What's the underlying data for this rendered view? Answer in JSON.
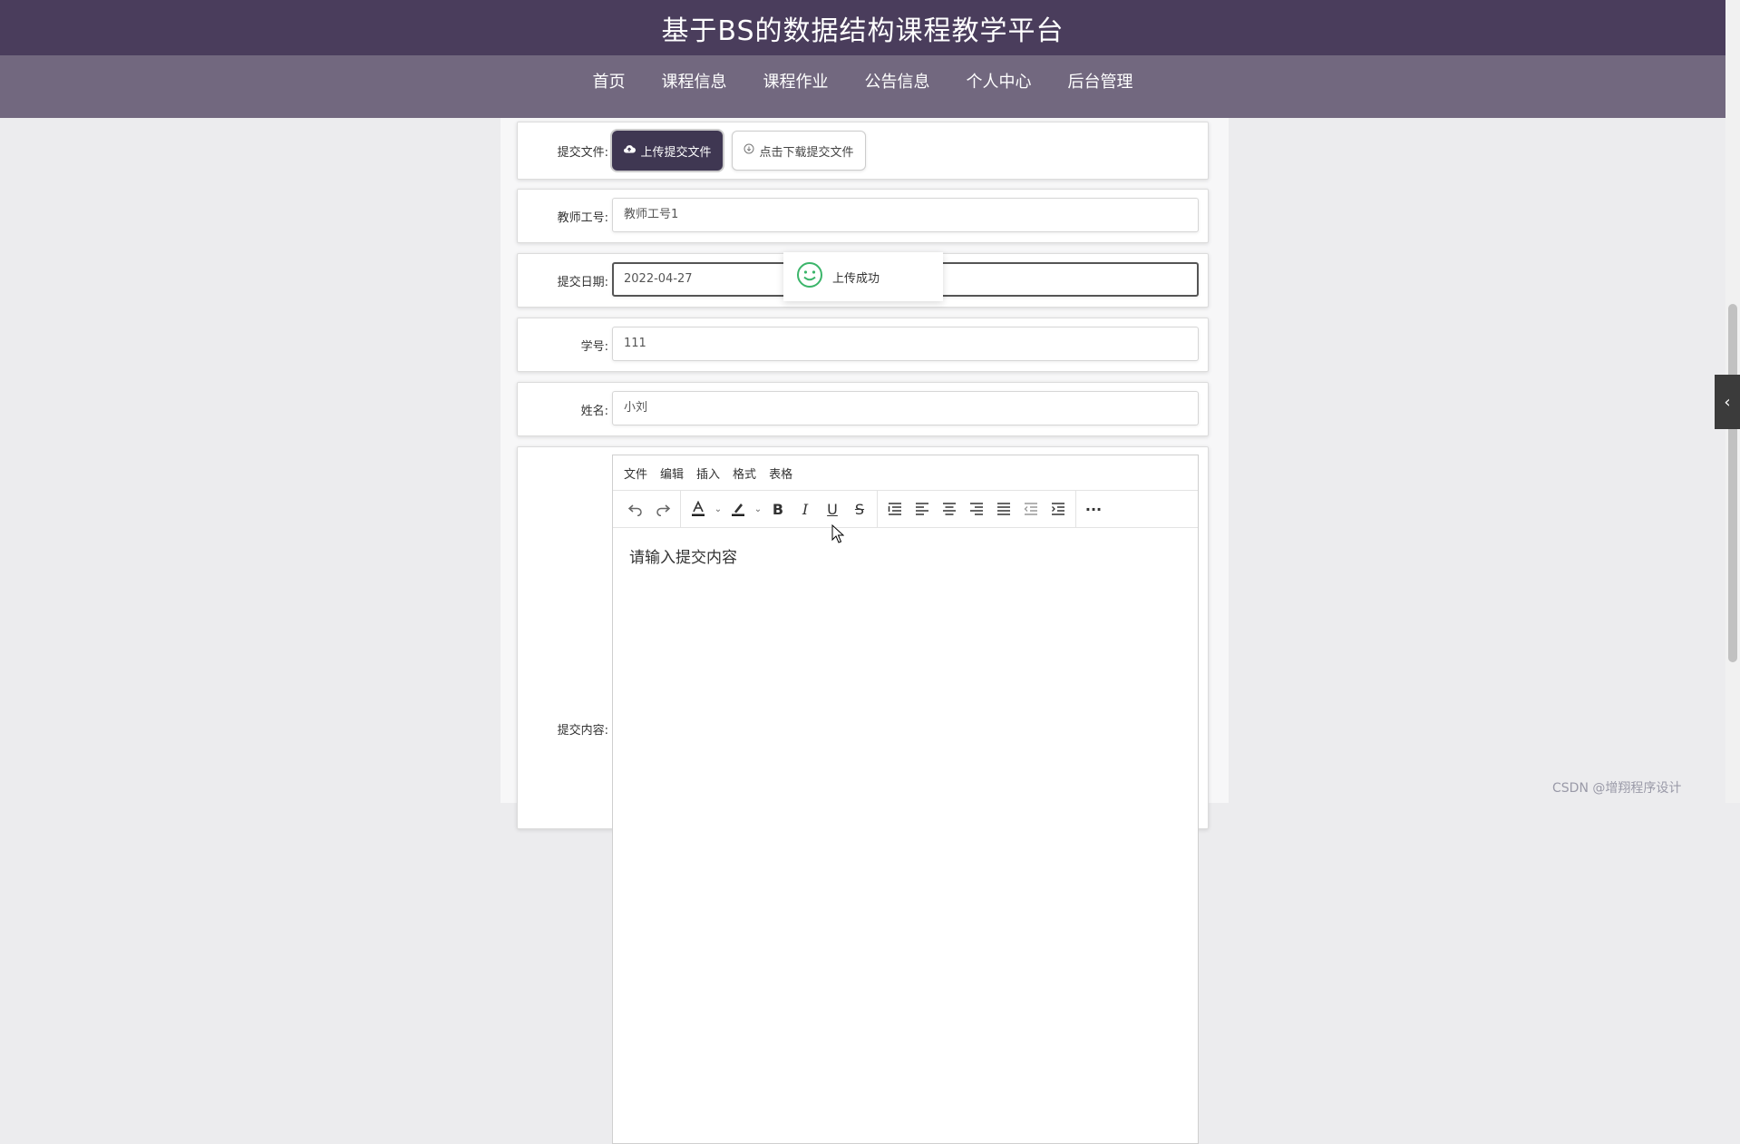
{
  "header": {
    "title": "基于BS的数据结构课程教学平台"
  },
  "nav": {
    "items": [
      {
        "label": "首页"
      },
      {
        "label": "课程信息"
      },
      {
        "label": "课程作业",
        "active": true
      },
      {
        "label": "公告信息"
      },
      {
        "label": "个人中心"
      },
      {
        "label": "后台管理"
      }
    ]
  },
  "form": {
    "file": {
      "label": "提交文件:",
      "upload_label": "上传提交文件",
      "download_label": "点击下载提交文件",
      "upload_icon": "cloud-upload-icon",
      "download_icon": "download-circle-icon"
    },
    "teacher_id": {
      "label": "教师工号:",
      "value": "教师工号1"
    },
    "date": {
      "label": "提交日期:",
      "value": "2022-04-27"
    },
    "student_id": {
      "label": "学号:",
      "value": "111"
    },
    "name": {
      "label": "姓名:",
      "value": "小刘"
    },
    "content": {
      "label": "提交内容:",
      "menu": [
        "文件",
        "编辑",
        "插入",
        "格式",
        "表格"
      ],
      "placeholder": "请输入提交内容"
    }
  },
  "toast": {
    "message": "上传成功",
    "icon": "smile-icon"
  },
  "watermark": "CSDN @增翔程序设计",
  "colors": {
    "title_bar": "#4a3d5c",
    "nav_bar": "#72687f",
    "primary_button": "#3f3752",
    "success_icon": "#3bb56a"
  }
}
